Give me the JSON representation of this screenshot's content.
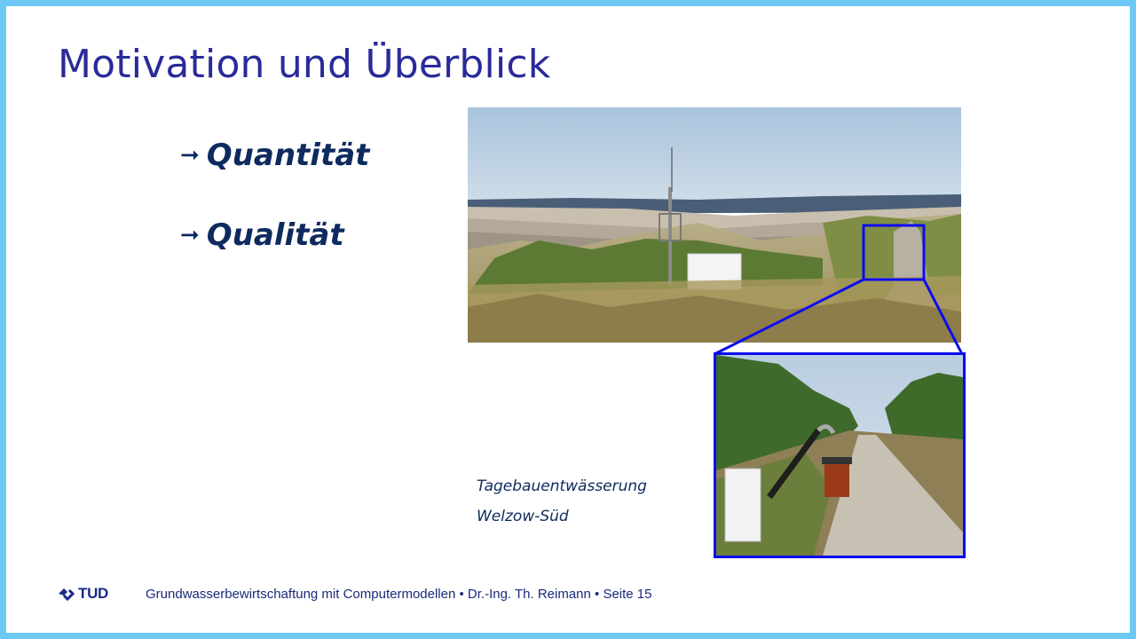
{
  "slide": {
    "title": "Motivation und Überblick",
    "bullets": [
      {
        "arrow": "➞",
        "text": "Quantität"
      },
      {
        "arrow": "➞",
        "text": "Qualität"
      }
    ],
    "caption": {
      "line1": "Tagebauentwässerung",
      "line2": "Welzow-Süd"
    }
  },
  "footer": {
    "logo_text": "TUD",
    "text": "Grundwasserbewirtschaftung mit Computermodellen • Dr.-Ing. Th. Reimann • Seite 15"
  },
  "colors": {
    "frame": "#6cc8f5",
    "title": "#2a2a9a",
    "text": "#0e2a5e",
    "inset_border": "#0c0cf0"
  }
}
